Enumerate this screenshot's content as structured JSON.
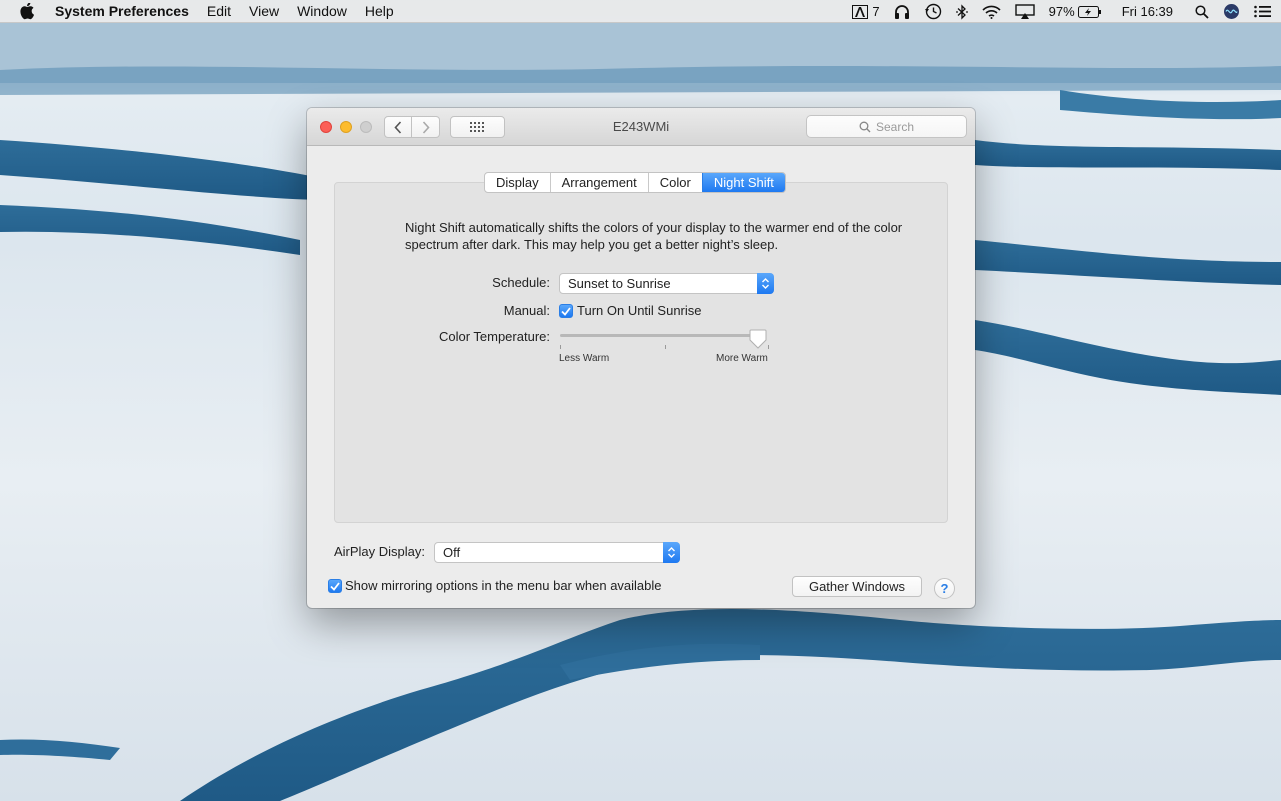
{
  "menubar": {
    "app_name": "System Preferences",
    "menus": [
      "Edit",
      "View",
      "Window",
      "Help"
    ],
    "status": {
      "adobe_count": "7",
      "battery_percent": "97%",
      "clock": "Fri 16:39"
    },
    "icons": [
      "apple-icon",
      "adobe-icon",
      "headphones-icon",
      "time-machine-icon",
      "bluetooth-icon",
      "wifi-icon",
      "airplay-icon",
      "battery-icon",
      "spotlight-icon",
      "siri-icon",
      "notification-center-icon"
    ]
  },
  "window": {
    "title": "E243WMi",
    "search_placeholder": "Search",
    "tabs": [
      {
        "label": "Display",
        "active": false
      },
      {
        "label": "Arrangement",
        "active": false
      },
      {
        "label": "Color",
        "active": false
      },
      {
        "label": "Night Shift",
        "active": true
      }
    ],
    "night_shift": {
      "description": "Night Shift automatically shifts the colors of your display to the warmer end of the color spectrum after dark. This may help you get a better night’s sleep.",
      "schedule_label": "Schedule:",
      "schedule_value": "Sunset to Sunrise",
      "manual_label": "Manual:",
      "manual_checkbox_label": "Turn On Until Sunrise",
      "manual_checked": true,
      "color_temp_label": "Color Temperature:",
      "slider_min_label": "Less Warm",
      "slider_max_label": "More Warm",
      "slider_value_fraction": 0.96
    },
    "airplay_label": "AirPlay Display:",
    "airplay_value": "Off",
    "mirroring_label": "Show mirroring options in the menu bar when available",
    "mirroring_checked": true,
    "gather_windows_label": "Gather Windows",
    "help_label": "?"
  },
  "colors": {
    "accent": "#1e79f1",
    "close": "#fc5f57",
    "minimize": "#fdbc2e"
  }
}
